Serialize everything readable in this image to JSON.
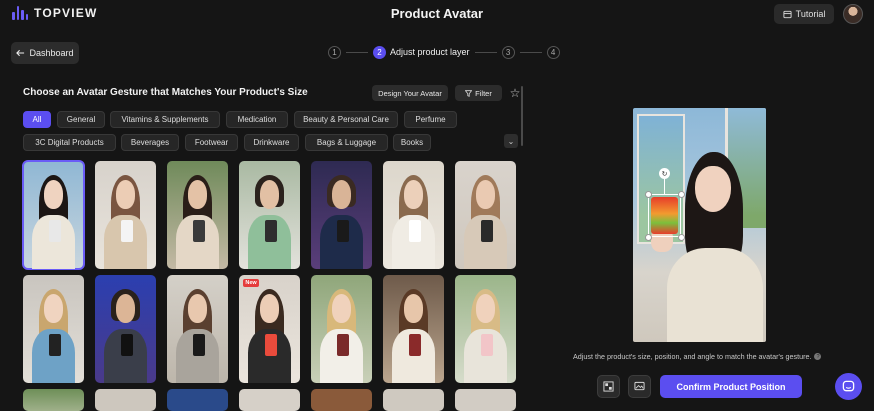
{
  "app": {
    "logo_text": "TOPVIEW",
    "page_title": "Product Avatar",
    "tutorial_label": "Tutorial",
    "accent_color": "#5b4ef0"
  },
  "nav": {
    "dashboard_label": "Dashboard"
  },
  "stepper": {
    "steps": [
      {
        "number": "1",
        "label": ""
      },
      {
        "number": "2",
        "label": "Adjust product layer"
      },
      {
        "number": "3",
        "label": ""
      },
      {
        "number": "4",
        "label": ""
      }
    ],
    "active_step": 2
  },
  "gesture_panel": {
    "title": "Choose an Avatar Gesture that Matches Your Product's Size",
    "design_avatar_label": "Design Your Avatar",
    "filter_label": "Filter",
    "categories": [
      "All",
      "General",
      "Vitamins & Supplements",
      "Medication",
      "Beauty & Personal Care",
      "Perfume",
      "3C Digital Products",
      "Beverages",
      "Footwear",
      "Drinkware",
      "Bags & Luggage",
      "Books"
    ],
    "active_category": "All",
    "new_badge": "New"
  },
  "preview": {
    "hint": "Adjust the product's size, position, and angle to match the avatar's gesture.",
    "confirm_label": "Confirm Product Position"
  },
  "icons": {
    "tutorial": "book-icon",
    "dashboard": "arrow-left-icon",
    "filter": "filter-icon",
    "favorite": "star-icon",
    "expand": "chevron-down-icon",
    "remove_bg": "remove-background-icon",
    "replace_image": "replace-image-icon",
    "chat": "chat-icon",
    "rotate": "rotate-icon",
    "info": "info-icon"
  }
}
